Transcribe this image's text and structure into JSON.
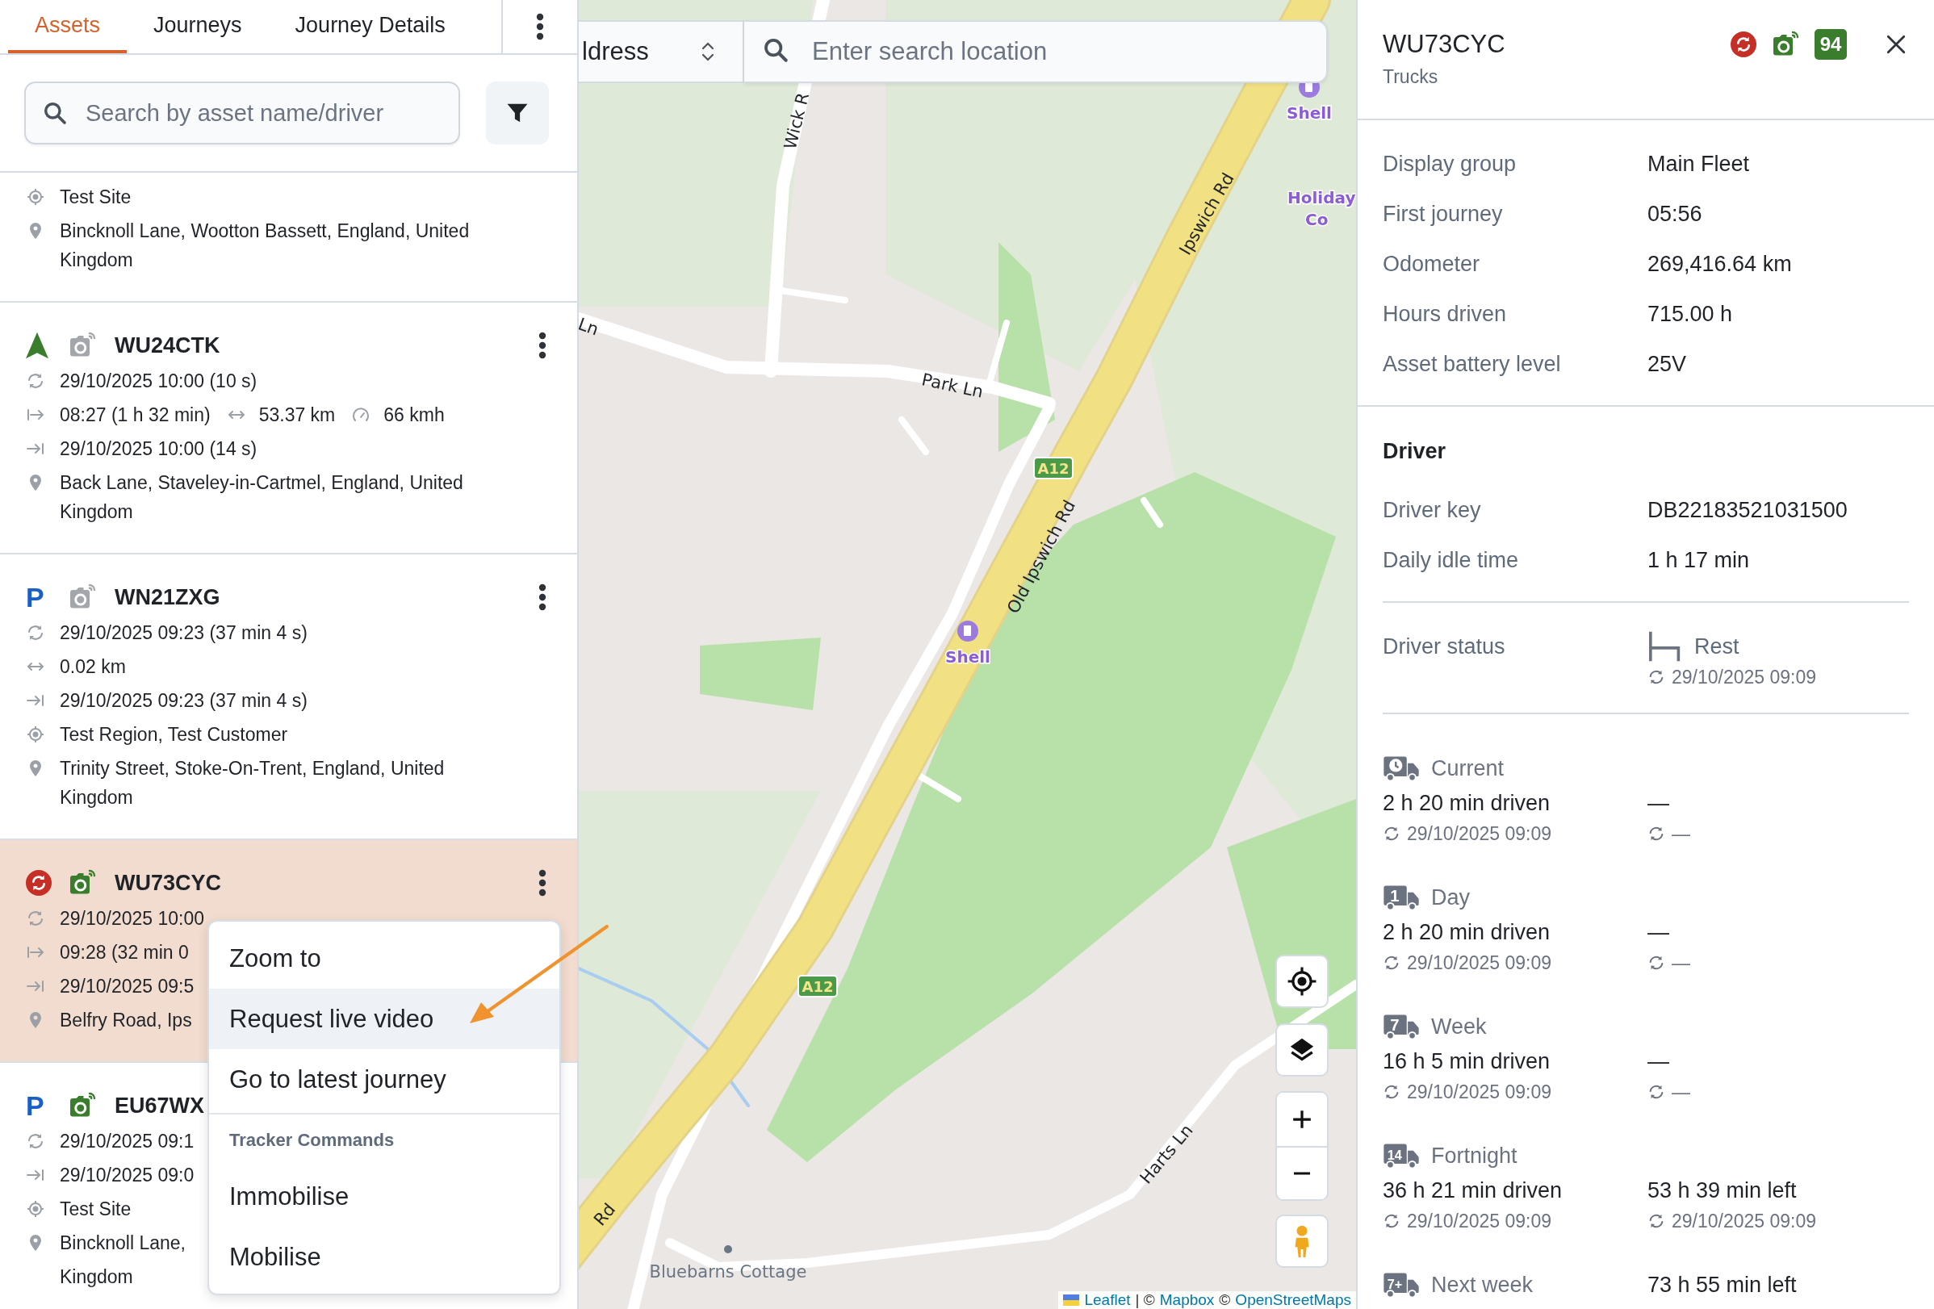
{
  "tabs": [
    {
      "label": "Assets",
      "selected": true
    },
    {
      "label": "Journeys",
      "selected": false
    },
    {
      "label": "Journey Details",
      "selected": false
    }
  ],
  "search": {
    "placeholder": "Search by asset name/driver"
  },
  "assets": [
    {
      "selected": false,
      "rows": [
        {
          "kind": "geofence",
          "text": "Test Site"
        },
        {
          "kind": "address",
          "text": "Bincknoll Lane, Wootton Bassett, England, United Kingdom"
        }
      ]
    },
    {
      "plate": "WU24CTK",
      "status": {
        "kind": "moving"
      },
      "camera_online": false,
      "selected": false,
      "rows": [
        {
          "kind": "sync",
          "text": "29/10/2025 10:00 (10 s)"
        },
        {
          "kind": "start",
          "text": "08:27 (1 h 32 min)",
          "extras": [
            {
              "kind": "distance",
              "text": "53.37 km"
            },
            {
              "kind": "speed",
              "text": "66 kmh"
            }
          ]
        },
        {
          "kind": "end",
          "text": "29/10/2025 10:00 (14 s)"
        },
        {
          "kind": "address",
          "text": "Back Lane, Staveley-in-Cartmel, England, United Kingdom"
        }
      ]
    },
    {
      "plate": "WN21ZXG",
      "status": {
        "kind": "parked",
        "glyph": "P"
      },
      "camera_online": false,
      "selected": false,
      "rows": [
        {
          "kind": "sync",
          "text": "29/10/2025 09:23 (37 min 4 s)"
        },
        {
          "kind": "distance",
          "text": "0.02 km"
        },
        {
          "kind": "end",
          "text": "29/10/2025 09:23 (37 min 4 s)"
        },
        {
          "kind": "geofence",
          "text": "Test Region, Test Customer"
        },
        {
          "kind": "address",
          "text": "Trinity Street, Stoke-On-Trent, England, United Kingdom"
        }
      ]
    },
    {
      "plate": "WU73CYC",
      "status": {
        "kind": "alert"
      },
      "camera_online": true,
      "selected": true,
      "rows": [
        {
          "kind": "sync",
          "text": "29/10/2025 10:00"
        },
        {
          "kind": "start",
          "text": "09:28 (32 min 0"
        },
        {
          "kind": "end",
          "text": "29/10/2025 09:5"
        },
        {
          "kind": "address",
          "text": "Belfry Road, Ips"
        }
      ]
    },
    {
      "plate": "EU67WX",
      "status": {
        "kind": "parked",
        "glyph": "P"
      },
      "camera_online": true,
      "selected": false,
      "rows": [
        {
          "kind": "sync",
          "text": "29/10/2025 09:1"
        },
        {
          "kind": "end",
          "text": "29/10/2025 09:0"
        },
        {
          "kind": "geofence",
          "text": "Test Site"
        },
        {
          "kind": "address",
          "text": "Bincknoll Lane,"
        },
        {
          "kind": "continuation",
          "text": "Kingdom"
        }
      ]
    }
  ],
  "context_menu": {
    "items": [
      {
        "kind": "item",
        "label": "Zoom to",
        "highlighted": false
      },
      {
        "kind": "item",
        "label": "Request live video",
        "highlighted": true
      },
      {
        "kind": "item",
        "label": "Go to latest journey",
        "highlighted": false
      },
      {
        "kind": "header",
        "label": "Tracker Commands"
      },
      {
        "kind": "item",
        "label": "Immobilise",
        "highlighted": false
      },
      {
        "kind": "item",
        "label": "Mobilise",
        "highlighted": false
      }
    ]
  },
  "map": {
    "mode_select": "ldress",
    "search_placeholder": "Enter search location",
    "labels": [
      {
        "kind": "road",
        "text": "Wick R"
      },
      {
        "kind": "road",
        "text": "Ln"
      },
      {
        "kind": "road",
        "text": "Park Ln"
      },
      {
        "kind": "road",
        "text": "Ipswich Rd"
      },
      {
        "kind": "poi",
        "text": "Shell"
      },
      {
        "kind": "place",
        "text": "Holiday"
      },
      {
        "kind": "place",
        "text": "Co"
      },
      {
        "kind": "road_number",
        "text": "A12"
      },
      {
        "kind": "road",
        "text": "Old Ipswich Rd"
      },
      {
        "kind": "poi",
        "text": "Shell"
      },
      {
        "kind": "road_number",
        "text": "A12"
      },
      {
        "kind": "road",
        "text": "Rd"
      },
      {
        "kind": "road",
        "text": "Harts Ln"
      },
      {
        "kind": "hamlet",
        "text": "Bluebarns Cottage"
      }
    ],
    "attribution": [
      {
        "kind": "link",
        "text": "Leaflet"
      },
      {
        "kind": "text",
        "text": "| ©"
      },
      {
        "kind": "link",
        "text": "Mapbox"
      },
      {
        "kind": "text",
        "text": "©"
      },
      {
        "kind": "link",
        "text": "OpenStreetMaps"
      }
    ]
  },
  "detail": {
    "plate": "WU73CYC",
    "group": "Trucks",
    "badge": "94",
    "info": [
      {
        "label": "Display group",
        "value": "Main Fleet"
      },
      {
        "label": "First journey",
        "value": "05:56"
      },
      {
        "label": "Odometer",
        "value": "269,416.64 km"
      },
      {
        "label": "Hours driven",
        "value": "715.00 h"
      },
      {
        "label": "Asset battery level",
        "value": "25V"
      }
    ],
    "driver": {
      "heading": "Driver",
      "rows": [
        {
          "label": "Driver key",
          "value": "DB22183521031500"
        },
        {
          "label": "Daily idle time",
          "value": "1 h 17 min"
        }
      ],
      "status": {
        "label": "Driver status",
        "value": "Rest",
        "time": "29/10/2025 09:09"
      }
    },
    "tacho": [
      {
        "kind": "current",
        "label": "Current",
        "driven": "2 h 20 min driven",
        "driven_time": "29/10/2025 09:09",
        "left": "—",
        "left_time": "—"
      },
      {
        "kind": "period",
        "badge": "1",
        "label": "Day",
        "driven": "2 h 20 min driven",
        "driven_time": "29/10/2025 09:09",
        "left": "—",
        "left_time": "—"
      },
      {
        "kind": "period",
        "badge": "7",
        "label": "Week",
        "driven": "16 h 5 min driven",
        "driven_time": "29/10/2025 09:09",
        "left": "—",
        "left_time": "—"
      },
      {
        "kind": "period",
        "badge": "14",
        "label": "Fortnight",
        "driven": "36 h 21 min driven",
        "driven_time": "29/10/2025 09:09",
        "left": "53 h 39 min left",
        "left_time": "29/10/2025 09:09"
      },
      {
        "kind": "period",
        "badge": "7+",
        "label": "Next week",
        "left": "73 h 55 min left"
      }
    ]
  }
}
